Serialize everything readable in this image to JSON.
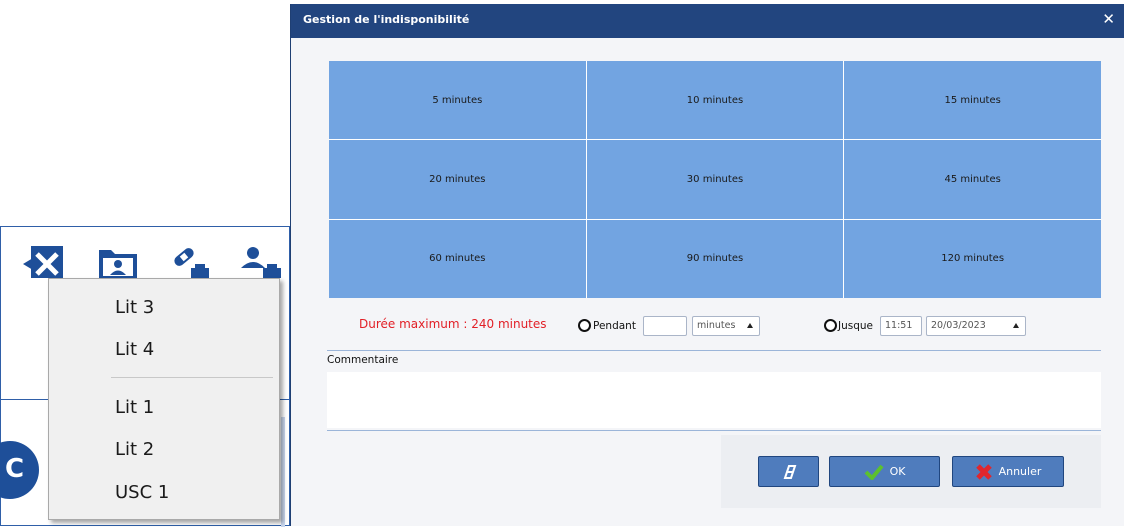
{
  "context_menu": {
    "items": [
      "Lit 3",
      "Lit 4",
      "Lit 1",
      "Lit 2",
      "USC 1"
    ]
  },
  "dialog": {
    "title": "Gestion de l'indisponibilité",
    "close_symbol": "✕",
    "durations": [
      "5 minutes",
      "10 minutes",
      "15 minutes",
      "20 minutes",
      "30 minutes",
      "45 minutes",
      "60 minutes",
      "90 minutes",
      "120 minutes"
    ],
    "max_duration_text": "Durée maximum : 240 minutes",
    "pendant": {
      "label": "Pendant",
      "value": "",
      "unit": "minutes"
    },
    "jusque": {
      "label": "Jusque",
      "time": "11:51",
      "date": "20/03/2023"
    },
    "comment": {
      "label": "Commentaire",
      "value": ""
    },
    "buttons": {
      "ok": "OK",
      "cancel": "Annuler"
    }
  },
  "icons": {
    "toolbar": [
      "close-x-icon",
      "folder-user-icon",
      "bandage-printer-icon",
      "user-printer-icon"
    ],
    "clear": "eraser-icon",
    "ok": "checkmark-icon",
    "cancel": "cross-icon"
  },
  "colors": {
    "titlebar": "#22457f",
    "duration_cell": "#72a4e1",
    "button": "#4f7cbd",
    "warning_text": "#e21f26",
    "app_blue": "#1e4f99"
  }
}
